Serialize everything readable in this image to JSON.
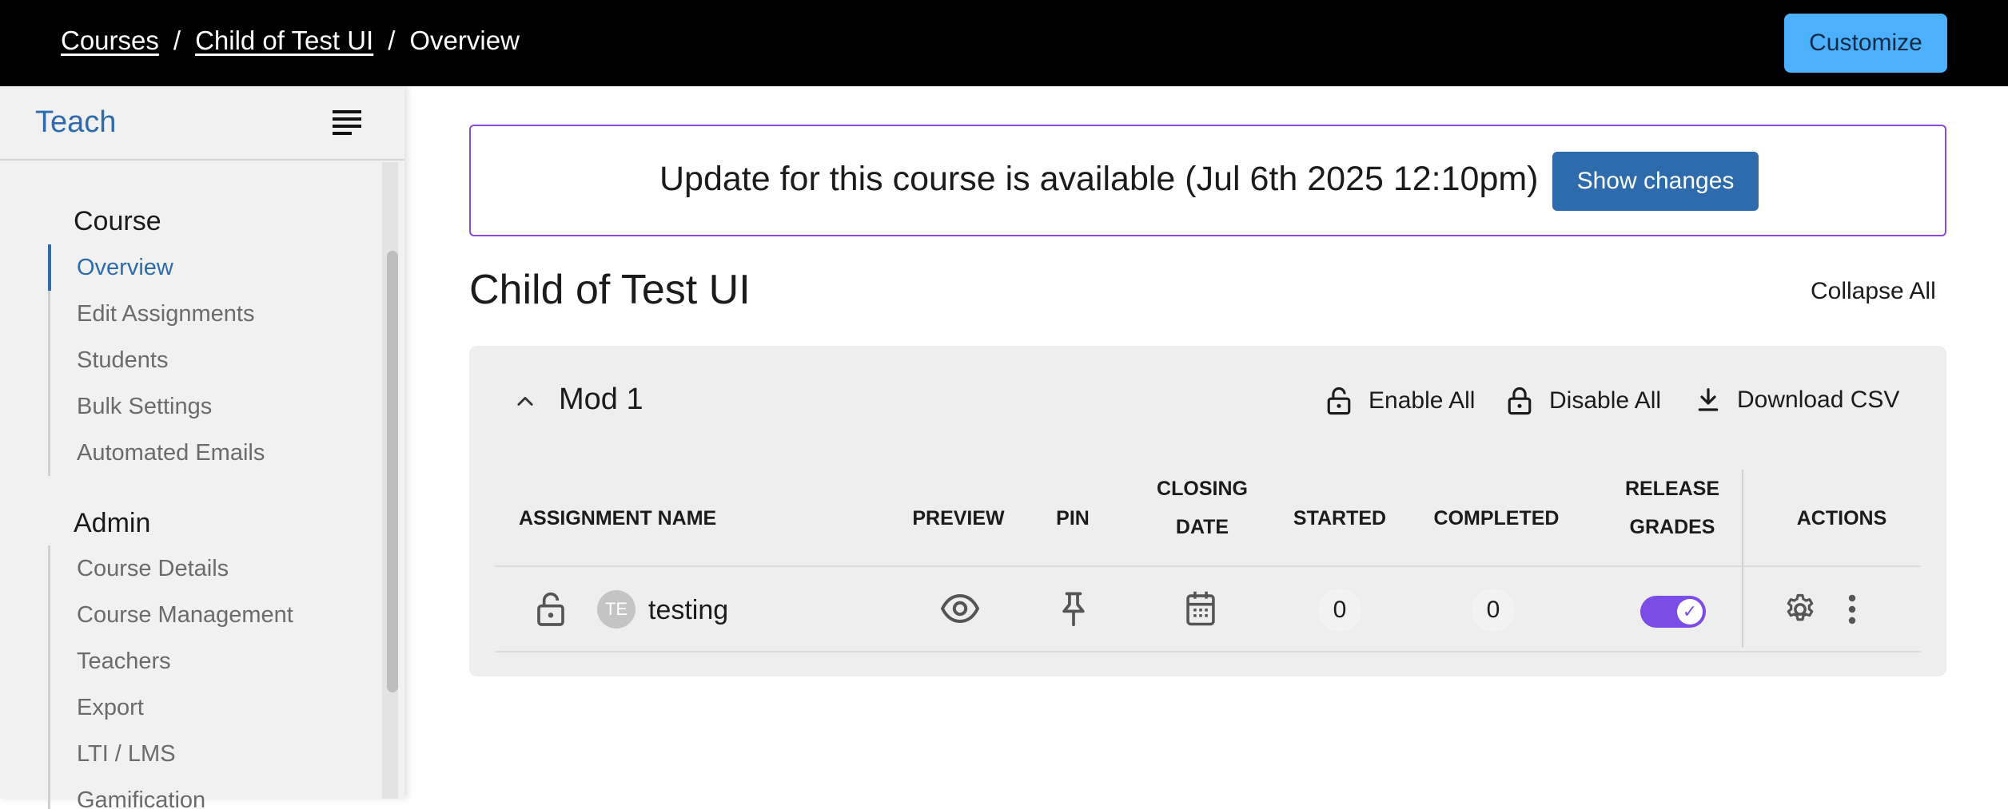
{
  "header": {
    "breadcrumbs": [
      "Courses",
      "Child of Test UI",
      "Overview"
    ],
    "separator": "/",
    "customize_label": "Customize"
  },
  "sidebar": {
    "brand": "Teach",
    "sections": [
      {
        "title": "Course",
        "items": [
          "Overview",
          "Edit Assignments",
          "Students",
          "Bulk Settings",
          "Automated Emails"
        ],
        "active": "Overview"
      },
      {
        "title": "Admin",
        "items": [
          "Course Details",
          "Course Management",
          "Teachers",
          "Export",
          "LTI / LMS",
          "Gamification"
        ]
      }
    ]
  },
  "banner": {
    "text": "Update for this course is available (Jul 6th 2025 12:10pm)",
    "button_label": "Show changes"
  },
  "page": {
    "title": "Child of Test UI",
    "collapse_all_label": "Collapse All"
  },
  "module": {
    "title": "Mod 1",
    "actions": {
      "enable_all": "Enable All",
      "disable_all": "Disable All",
      "download_csv": "Download CSV"
    },
    "columns": {
      "assignment_name": "ASSIGNMENT NAME",
      "preview": "PREVIEW",
      "pin": "PIN",
      "closing_1": "CLOSING",
      "closing_2": "DATE",
      "started": "STARTED",
      "completed": "COMPLETED",
      "release_1": "RELEASE",
      "release_2": "GRADES",
      "actions": "ACTIONS"
    },
    "rows": [
      {
        "avatar_initials": "TE",
        "name": "testing",
        "started": "0",
        "completed": "0",
        "release_grades": true
      }
    ]
  },
  "colors": {
    "topbar": "#000000",
    "accent": "#2e6bad",
    "customize": "#4db0fd",
    "banner_border": "#8a4bd8",
    "toggle": "#7b4ce6"
  }
}
